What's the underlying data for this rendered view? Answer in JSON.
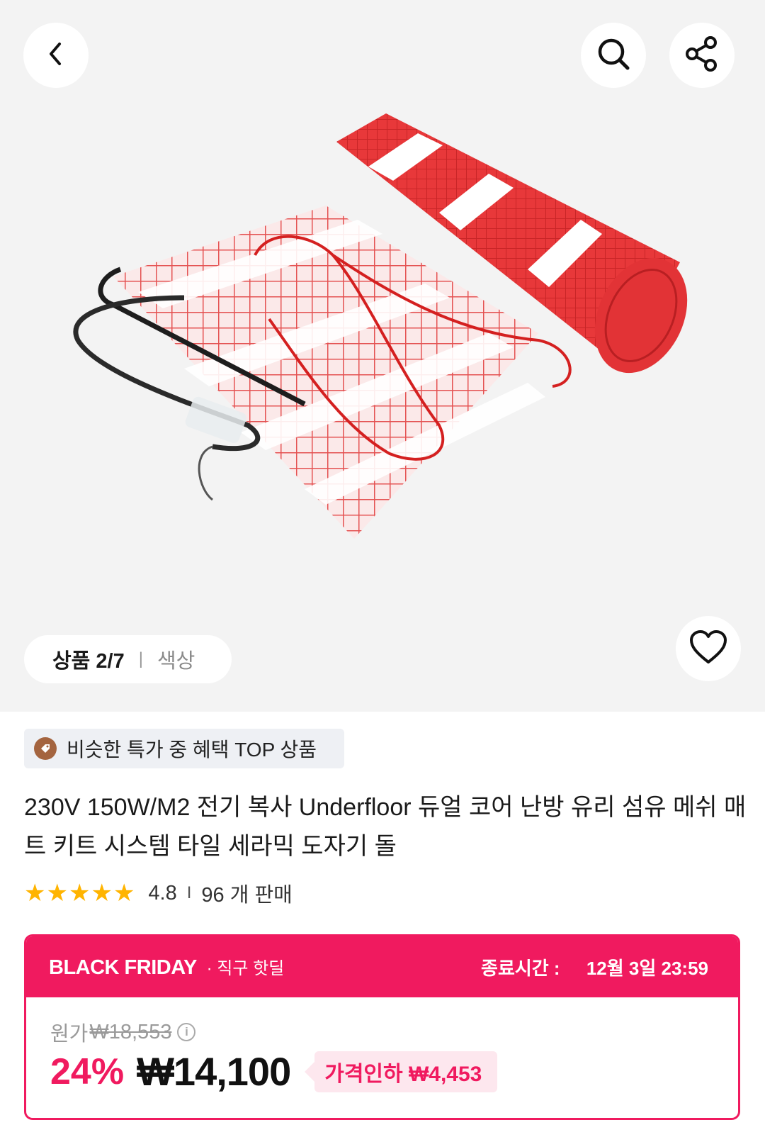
{
  "gallery": {
    "counter": "상품 2/7",
    "separator": "|",
    "color_label": "색상"
  },
  "icons": {
    "back": "chevron-left-icon",
    "search": "search-icon",
    "share": "share-icon",
    "like": "heart-icon",
    "badge": "tag-icon"
  },
  "badge": {
    "label": "비슷한 특가 중 혜택 TOP 상품"
  },
  "product": {
    "title": "230V 150W/M2 전기 복사 Underfloor 듀얼 코어 난방 유리 섬유 메쉬 매트 키트 시스템 타일 세라믹 도자기 돌",
    "rating": "4.8",
    "rating_value": 4.8,
    "divider": "I",
    "sold": "96 개 판매"
  },
  "deal": {
    "brand": "BLACK FRIDAY",
    "sub": "· 직구 핫딜",
    "end_label": "종료시간 :",
    "end_time": "12월 3일 23:59",
    "orig_label": "원가",
    "orig_price": "₩18,553",
    "discount": "24%",
    "price": "₩14,100",
    "drop_label": "가격인하 ₩4,453"
  },
  "colors": {
    "accent": "#f01a5f",
    "star": "#ffb400",
    "mat": "#e8383a",
    "badge_bg": "#eef0f4"
  }
}
